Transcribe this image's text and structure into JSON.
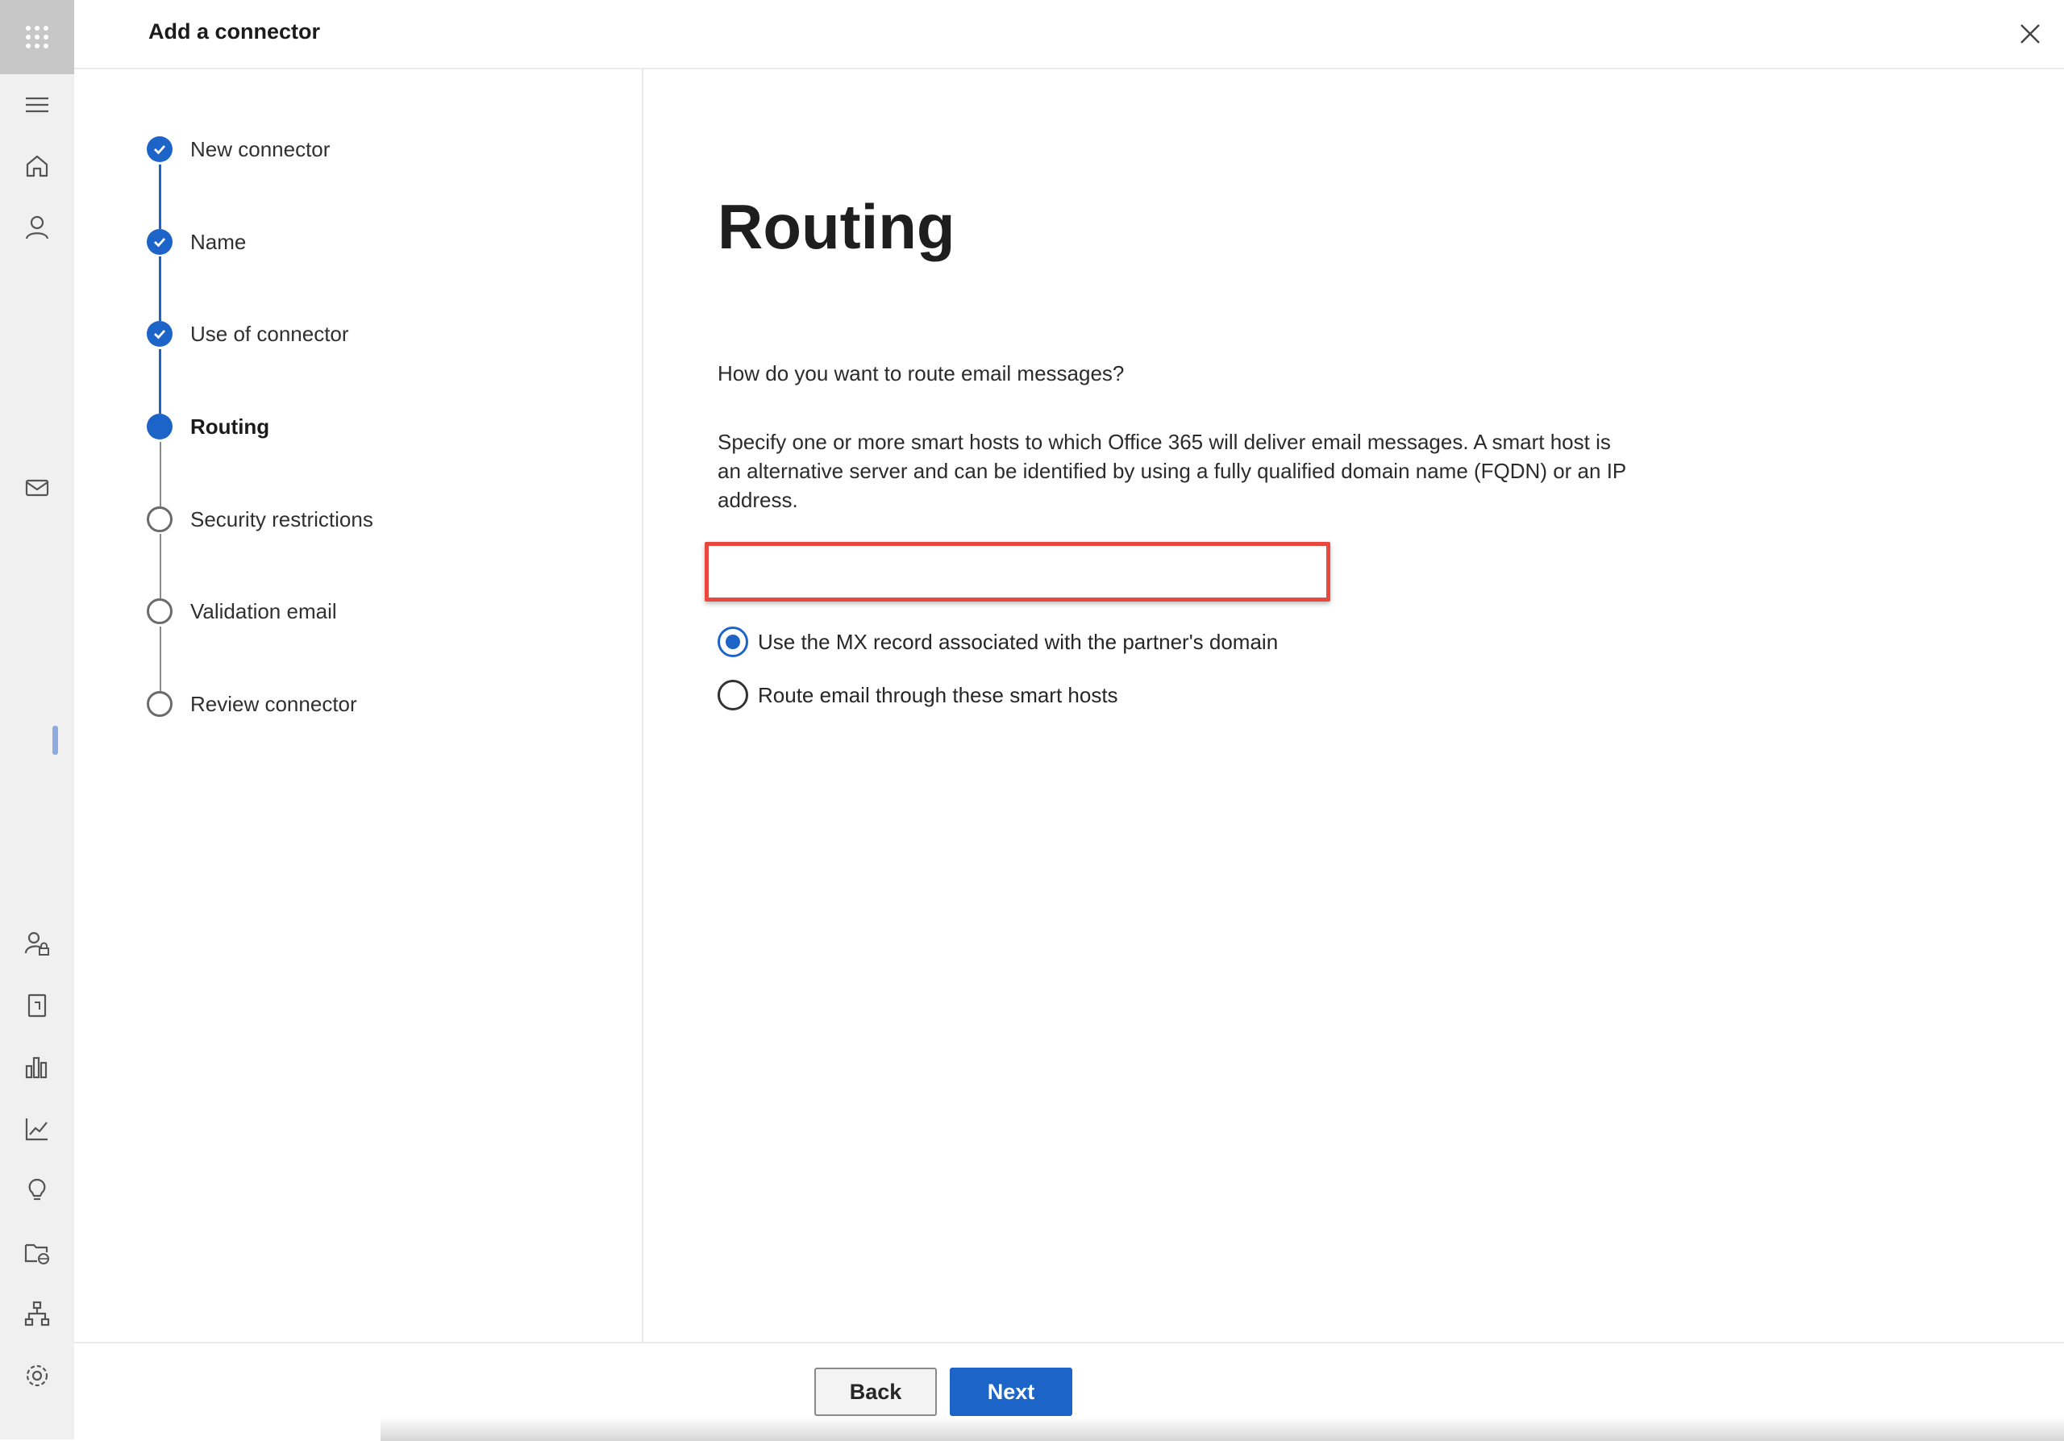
{
  "header": {
    "title": "Add a connector",
    "close_icon": "close-icon"
  },
  "rail": {
    "icons": [
      "app-launcher-icon",
      "hamburger-menu-icon",
      "home-icon",
      "person-icon",
      "mail-icon",
      "user-lock-icon",
      "document-icon",
      "reports-icon",
      "line-chart-icon",
      "lightbulb-icon",
      "folder-globe-icon",
      "org-chart-icon",
      "settings-icon"
    ]
  },
  "steps": [
    {
      "label": "New connector",
      "state": "done"
    },
    {
      "label": "Name",
      "state": "done"
    },
    {
      "label": "Use of connector",
      "state": "done"
    },
    {
      "label": "Routing",
      "state": "current"
    },
    {
      "label": "Security restrictions",
      "state": "pending"
    },
    {
      "label": "Validation email",
      "state": "pending"
    },
    {
      "label": "Review connector",
      "state": "pending"
    }
  ],
  "main": {
    "title": "Routing",
    "question": "How do you want to route email messages?",
    "description": "Specify one or more smart hosts to which Office 365 will deliver email messages. A smart host is an alternative server and can be identified by using a fully qualified domain name (FQDN) or an IP address.",
    "options": [
      {
        "label": "Use the MX record associated with the partner's domain",
        "selected": true
      },
      {
        "label": "Route email through these smart hosts",
        "selected": false
      }
    ]
  },
  "footer": {
    "back_label": "Back",
    "next_label": "Next"
  },
  "colors": {
    "accent": "#1d64c9",
    "highlight": "#e8483d"
  }
}
